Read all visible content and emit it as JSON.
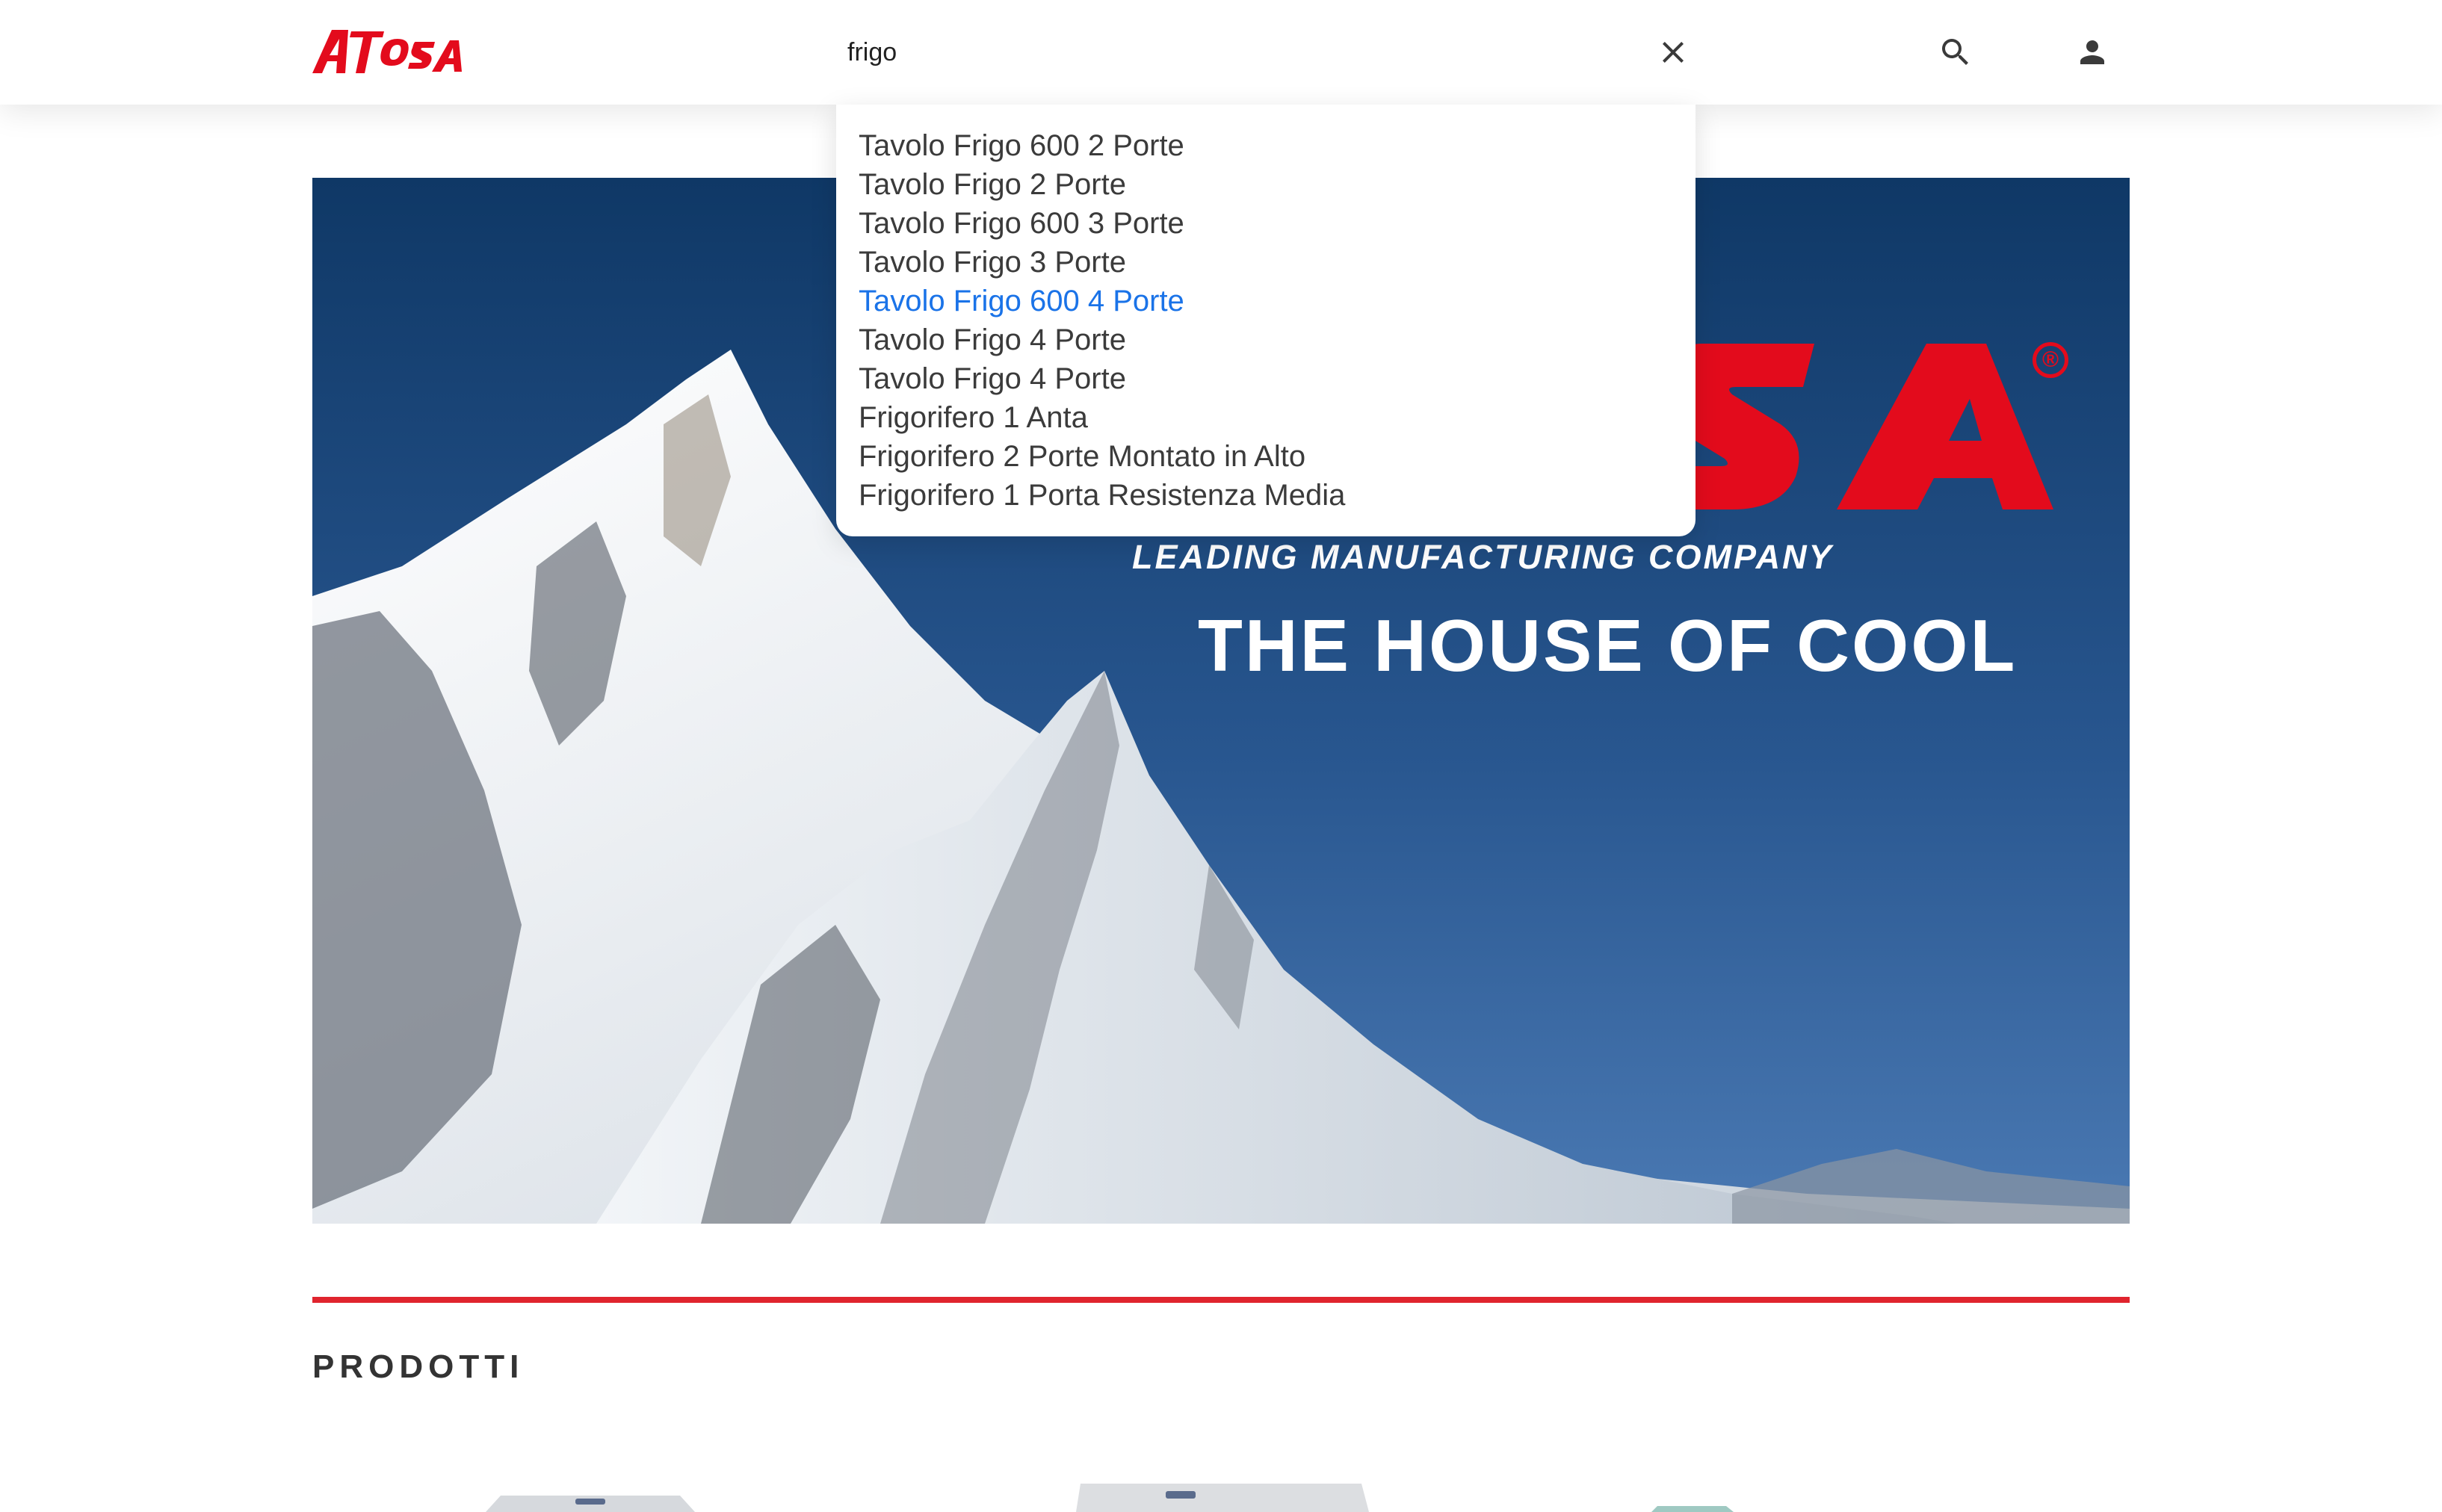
{
  "header": {
    "logo_text": "ATOSA",
    "search": {
      "value": "frigo",
      "placeholder": ""
    },
    "icons": {
      "clear": "close-icon",
      "search": "search-icon",
      "account": "person-icon"
    }
  },
  "search_suggestions": {
    "items": [
      "Tavolo Frigo 600 2 Porte",
      "Tavolo Frigo 2 Porte",
      "Tavolo Frigo 600 3 Porte",
      "Tavolo Frigo 3 Porte",
      "Tavolo Frigo 600 4 Porte",
      "Tavolo Frigo 4 Porte",
      "Tavolo Frigo 4 Porte",
      "Frigorifero 1 Anta",
      "Frigorifero 2 Porte Montato in Alto",
      "Frigorifero 1 Porta Resistenza Media"
    ],
    "highlighted_index": 4
  },
  "hero": {
    "brand_logo": "ATOSA",
    "registered_mark": "®",
    "tagline": "LEADING MANUFACTURING COMPANY",
    "headline": "THE HOUSE OF COOL"
  },
  "products": {
    "section_title": "PRODOTTI"
  },
  "colors": {
    "brand_red": "#e30b1c",
    "divider_red": "#e0242e",
    "link_blue": "#1a73e8",
    "sky_top": "#103a68",
    "sky_bottom": "#3d6ca6"
  }
}
